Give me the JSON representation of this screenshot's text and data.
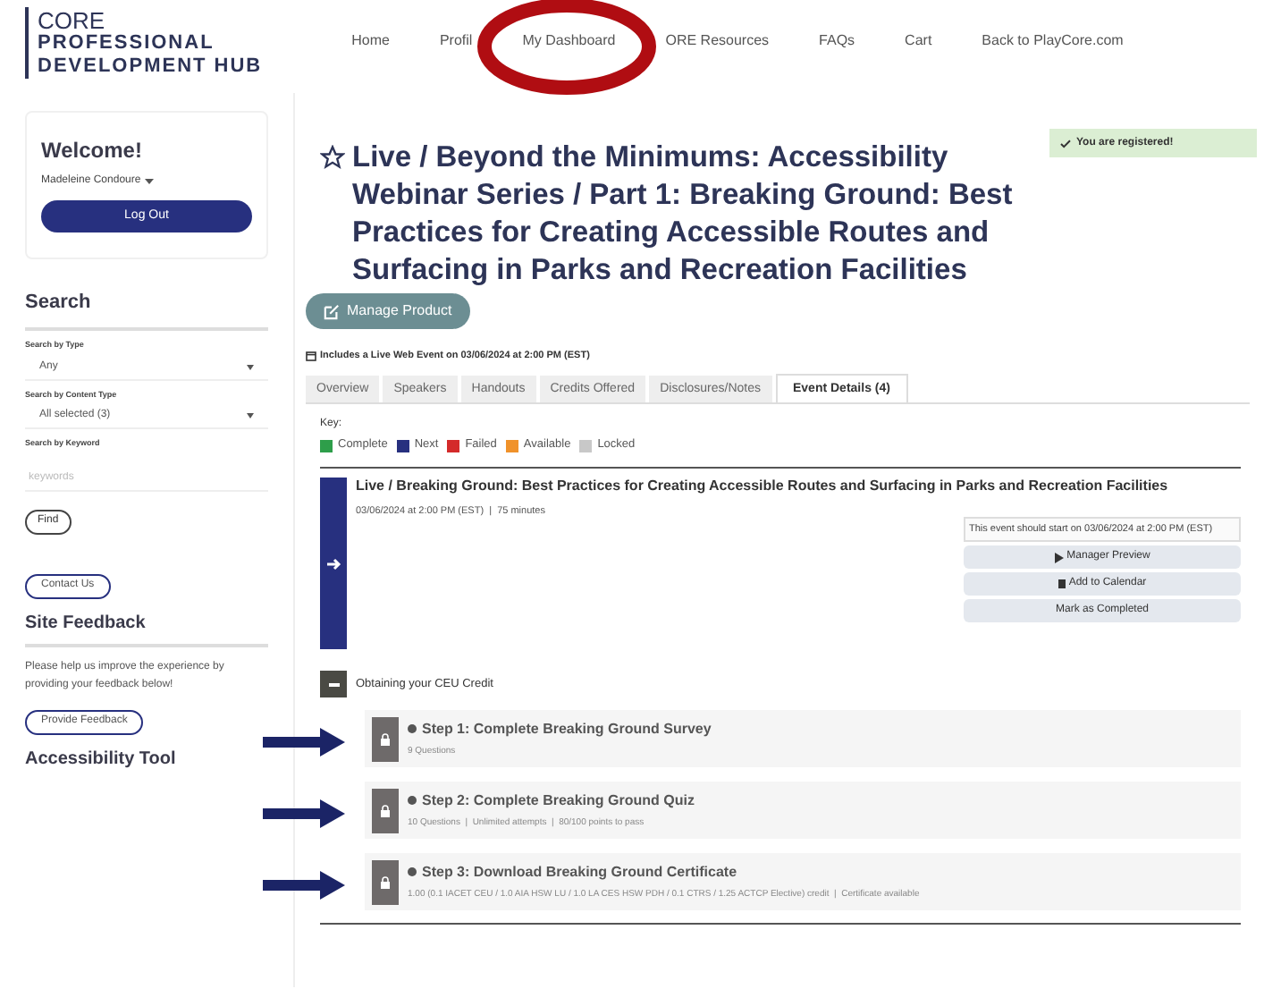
{
  "header": {
    "logo": {
      "brand": "CORE",
      "line1": "PROFESSIONAL",
      "line2": "DEVELOPMENT HUB"
    },
    "nav": [
      {
        "label": "Home"
      },
      {
        "label": "Profil"
      },
      {
        "label": "My Dashboard"
      },
      {
        "label": "ORE Resources"
      },
      {
        "label": "FAQs"
      },
      {
        "label": "Cart"
      },
      {
        "label": "Back to PlayCore.com"
      }
    ]
  },
  "sidebar": {
    "welcome": "Welcome!",
    "user": "Madeleine Condoure",
    "logout": "Log Out",
    "search_title": "Search",
    "fields": [
      {
        "kind": "select",
        "label": "Search by Type",
        "value": "Any"
      },
      {
        "kind": "select",
        "label": "Search by Content Type",
        "value": "All selected (3)"
      },
      {
        "kind": "text",
        "label": "Search by Keyword",
        "placeholder": "keywords"
      }
    ],
    "find": "Find",
    "contact": "Contact Us",
    "feedback_title": "Site Feedback",
    "feedback_text": "Please help us improve the experience by providing your feedback below!",
    "feedback_button": "Provide Feedback",
    "accessibility_title": "Accessibility Tool"
  },
  "main": {
    "registered": "You are registered!",
    "title": "Live / Beyond the Minimums: Accessibility Webinar Series / Part 1: Breaking Ground: Best Practices for Creating Accessible Routes and Surfacing in Parks and Recreation Facilities",
    "manage": "Manage Product",
    "live_note": "Includes a Live Web Event on 03/06/2024 at 2:00 PM (EST)",
    "tabs": [
      {
        "label": "Overview",
        "selected": false
      },
      {
        "label": "Speakers",
        "selected": false
      },
      {
        "label": "Handouts",
        "selected": false
      },
      {
        "label": "Credits Offered",
        "selected": false
      },
      {
        "label": "Disclosures/Notes",
        "selected": false
      },
      {
        "label": "Event Details (4)",
        "selected": true
      }
    ],
    "key_title": "Key:",
    "key": [
      {
        "label": "Complete",
        "color": "#2e9e4a"
      },
      {
        "label": "Next",
        "color": "#27307f"
      },
      {
        "label": "Failed",
        "color": "#d42a2a"
      },
      {
        "label": "Available",
        "color": "#f0922a"
      },
      {
        "label": "Locked",
        "color": "#c8c8c8"
      }
    ],
    "event": {
      "title": "Live / Breaking Ground: Best Practices for Creating Accessible Routes and Surfacing in Parks and Recreation Facilities",
      "meta": "03/06/2024 at 2:00 PM (EST)  |  75 minutes",
      "notice": "This event should start on 03/06/2024 at 2:00 PM (EST)",
      "actions": [
        "Manager Preview",
        "Add to Calendar",
        "Mark as Completed"
      ]
    },
    "section": {
      "title": "Obtaining your CEU Credit",
      "expanded": true,
      "steps": [
        {
          "title": "Step 1: Complete Breaking Ground Survey",
          "meta": "9 Questions"
        },
        {
          "title": "Step 2: Complete Breaking Ground Quiz",
          "meta": "10 Questions  |  Unlimited attempts  |  80/100 points to pass"
        },
        {
          "title": "Step 3: Download Breaking Ground Certificate",
          "meta": "1.00 (0.1 IACET CEU / 1.0 AIA HSW LU / 1.0 LA CES HSW PDH / 0.1 CTRS / 1.25 ACTCP Elective) credit  |  Certificate available"
        }
      ]
    }
  }
}
